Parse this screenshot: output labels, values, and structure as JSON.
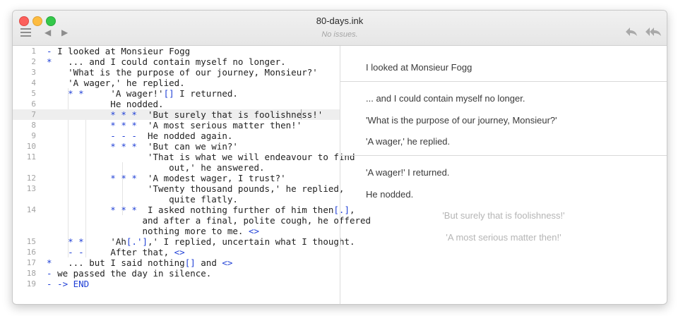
{
  "window": {
    "title": "80-days.ink",
    "status": "No issues."
  },
  "toolbar": {
    "back_arrow": "◀",
    "forward_arrow": "▶",
    "rewind_glyph": "⮪",
    "rewind_all_glyph": "⮪⮪"
  },
  "editor": {
    "line_numbers": [
      "1",
      "2",
      "3",
      "4",
      "5",
      "6",
      "7",
      "8",
      "9",
      "10",
      "11",
      "12",
      "13",
      "14",
      "15",
      "16",
      "17",
      "18",
      "19"
    ],
    "lines": [
      {
        "mark": "- ",
        "text": "I looked at Monsieur Fogg"
      },
      {
        "mark": "*",
        "text": "   ... and I could contain myself no longer."
      },
      {
        "text": "    'What is the purpose of our journey, Monsieur?'"
      },
      {
        "text": "    'A wager,' he replied."
      },
      {
        "mark": "    * *",
        "text": "     'A wager!'",
        "bracket": "[]",
        "after": " I returned."
      },
      {
        "text": "            He nodded."
      },
      {
        "mark": "            * * *",
        "text": "  'But surely that is foolishness!'"
      },
      {
        "mark": "            * * *",
        "text": "  'A most serious matter then!'"
      },
      {
        "mark": "            - - -",
        "text": "  He nodded again."
      },
      {
        "mark": "            * * *",
        "text": "  'But can we win?'"
      },
      {
        "text": "                   'That is what we will endeavour to find"
      },
      {
        "text": "                       out,' he answered."
      },
      {
        "mark": "            * * *",
        "text": "  'A modest wager, I trust?'"
      },
      {
        "text": "                   'Twenty thousand pounds,' he replied,"
      },
      {
        "text": "                       quite flatly."
      },
      {
        "mark": "            * * *",
        "text": "  I asked nothing further of him then",
        "bracket": "[.]",
        "after": ","
      },
      {
        "text": "                  and after a final, polite cough, he offered"
      },
      {
        "text": "                  nothing more to me. ",
        "divert": "<>"
      },
      {
        "mark": "    * *",
        "text": "     'Ah",
        "bracket": "[.']",
        "after": ",' I replied, uncertain what I thought."
      },
      {
        "mark": "    - -",
        "text": "     After that, ",
        "divert": "<>"
      },
      {
        "mark": "*",
        "text": "   ... but I said nothing",
        "bracket": "[]",
        "after": " and ",
        "divert": "<>"
      },
      {
        "mark": "- ",
        "text": "we passed the day in silence."
      },
      {
        "mark": "- -> END",
        "text": ""
      }
    ]
  },
  "player": {
    "p1": "I looked at Monsieur Fogg",
    "p2": "... and I could contain myself no longer.",
    "p3": "'What is the purpose of our journey, Monsieur?'",
    "p4": "'A wager,' he replied.",
    "p5": "'A wager!' I returned.",
    "p6": "He nodded.",
    "choice1": "'But surely that is foolishness!'",
    "choice2": "'A most serious matter then!'"
  },
  "colors": {
    "ink_blue": "#1f3fd6",
    "line_number": "#a3a3a3",
    "choice": "#b5b5b5"
  }
}
